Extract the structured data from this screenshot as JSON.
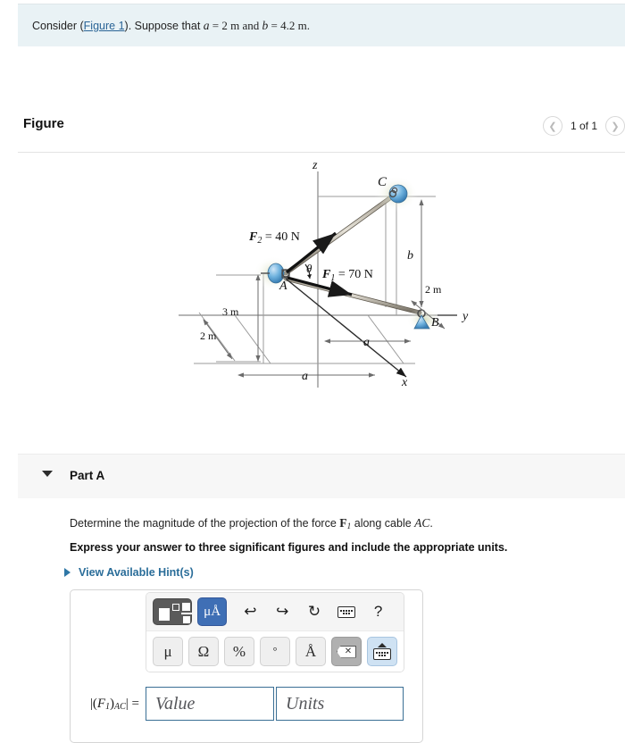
{
  "statement": {
    "prefix": "Consider (",
    "figure_link": "Figure 1",
    "middle": "). Suppose that ",
    "var_a": "a",
    "eq1": " = 2 m and ",
    "var_b": "b",
    "eq2": " = 4.2 m."
  },
  "figure": {
    "title": "Figure",
    "counter": "1 of 1",
    "prev_icon": "chevron-left-icon",
    "next_icon": "chevron-right-icon",
    "diagram": {
      "axis_z": "z",
      "axis_y": "y",
      "axis_x": "x",
      "point_a": "A",
      "point_b": "B",
      "point_c": "C",
      "force_1": "F",
      "force_1_sub": "1",
      "force_1_value": " = 70 N",
      "force_2": "F",
      "force_2_sub": "2",
      "force_2_value": " = 40 N",
      "angle_theta": "θ",
      "dim_b": "b",
      "dim_a_lower": "a",
      "dim_a_bottom": "a",
      "dim_2m_right": "2 m",
      "dim_3m": "3 m",
      "dim_2m_left": "2 m"
    }
  },
  "part": {
    "caret_icon": "caret-down-icon",
    "title": "Part A",
    "question_prefix": "Determine the magnitude of the projection of the force ",
    "question_force": "F",
    "question_force_sub": "1",
    "question_middle": " along cable ",
    "question_cable": "AC",
    "question_suffix": ".",
    "instruction": "Express your answer to three significant figures and include the appropriate units.",
    "hints_label": "View Available Hint(s)",
    "hints_caret_icon": "caret-right-icon"
  },
  "answer": {
    "toolbar": {
      "template_button": "template-icon",
      "units_button": "μÅ",
      "undo_icon": "undo-arrow-icon",
      "redo_icon": "redo-arrow-icon",
      "reset_icon": "reset-circle-icon",
      "keyboard_icon": "keyboard-icon",
      "help_icon": "?",
      "symbols": [
        {
          "label": "μ",
          "name": "symbol-mu-button"
        },
        {
          "label": "Ω",
          "name": "symbol-omega-button"
        },
        {
          "label": "%",
          "name": "symbol-percent-button"
        },
        {
          "label": "°",
          "name": "symbol-degree-button"
        },
        {
          "label": "Å",
          "name": "symbol-angstrom-button"
        }
      ],
      "backspace_icon": "backspace-icon",
      "eject_keyboard_icon": "eject-keyboard-icon"
    },
    "label_abs_open": "|(",
    "label_force": "F",
    "label_force_sub": "1",
    "label_abs_close": ")",
    "label_cable_sub": "AC",
    "label_tail": "| =",
    "value_placeholder": "Value",
    "units_placeholder": "Units"
  },
  "colors": {
    "banner_bg": "#e9f2f5",
    "link": "#2a6496",
    "hint_link": "#2a6d99",
    "input_border": "#3a6f95",
    "accent_blue": "#3f6fb5"
  }
}
